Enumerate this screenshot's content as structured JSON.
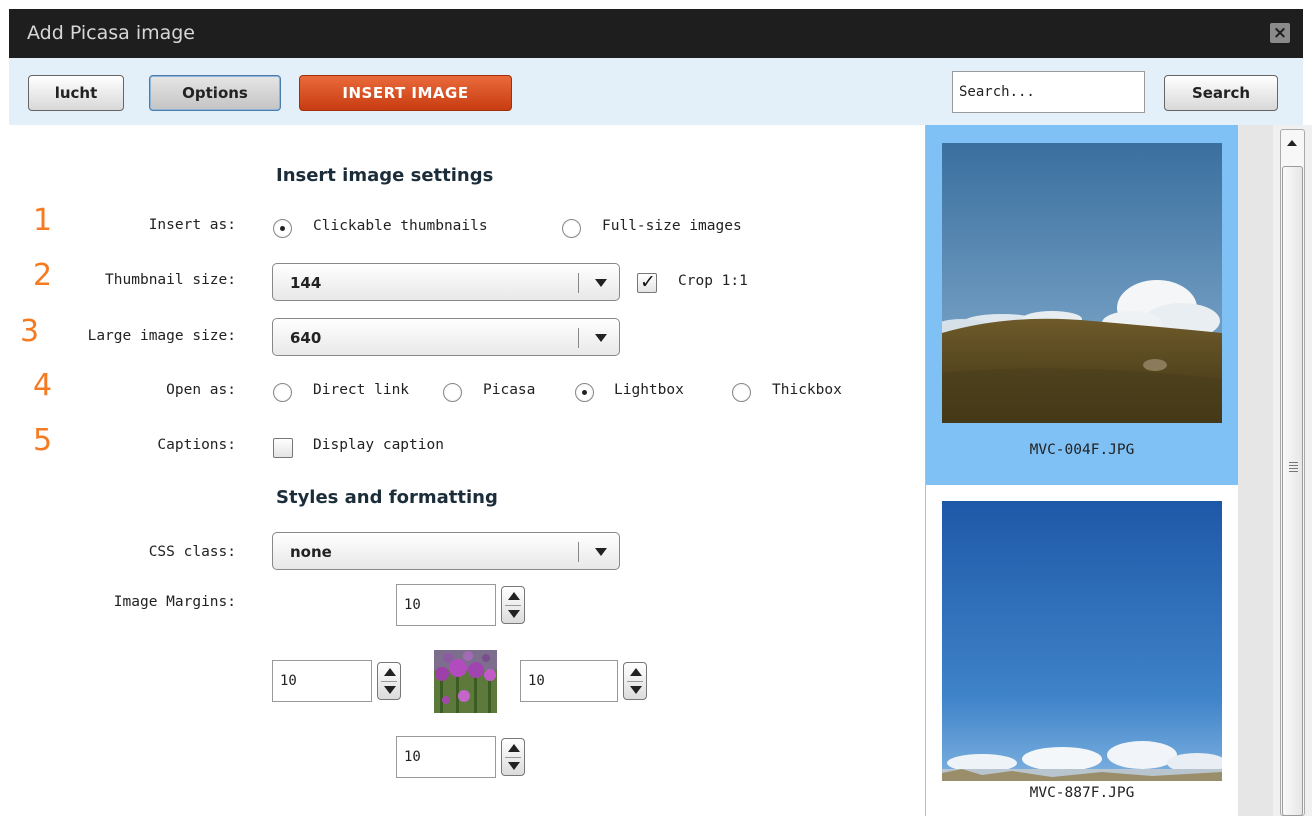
{
  "window": {
    "title": "Add Picasa image",
    "close_icon": "close-icon"
  },
  "toolbar": {
    "user_button": "lucht",
    "options_button": "Options",
    "insert_button": "INSERT IMAGE",
    "search_placeholder": "Search...",
    "search_button": "Search"
  },
  "colors": {
    "title_bar": "#1e1e1e",
    "toolbar_bg": "#e3eff9",
    "insert_button": "#d9501f",
    "step_numbers": "#f57a22",
    "selected_thumb": "#7fc1f5"
  },
  "insert_settings": {
    "heading": "Insert image settings",
    "steps": [
      "1",
      "2",
      "3",
      "4",
      "5"
    ],
    "insert_as": {
      "label": "Insert as:",
      "options": [
        "Clickable thumbnails",
        "Full-size images"
      ],
      "selected": "Clickable thumbnails"
    },
    "thumbnail_size": {
      "label": "Thumbnail size:",
      "value": "144",
      "crop_label": "Crop 1:1",
      "crop_checked": true
    },
    "large_image_size": {
      "label": "Large image size:",
      "value": "640"
    },
    "open_as": {
      "label": "Open as:",
      "options": [
        "Direct link",
        "Picasa",
        "Lightbox",
        "Thickbox"
      ],
      "selected": "Lightbox"
    },
    "captions": {
      "label": "Captions:",
      "checkbox_label": "Display caption",
      "checked": false
    }
  },
  "styles": {
    "heading": "Styles and formatting",
    "css_class": {
      "label": "CSS class:",
      "value": "none"
    },
    "image_margins": {
      "label": "Image Margins:",
      "top": "10",
      "left": "10",
      "right": "10",
      "bottom": "10"
    }
  },
  "images": [
    {
      "filename": "MVC-004F.JPG",
      "selected": true
    },
    {
      "filename": "MVC-887F.JPG",
      "selected": false
    }
  ]
}
